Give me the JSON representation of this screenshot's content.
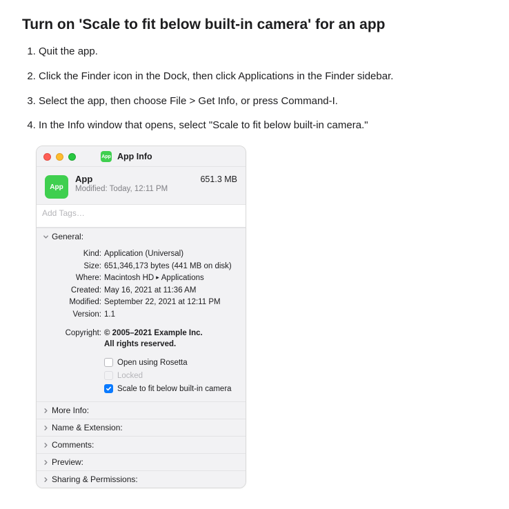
{
  "page": {
    "title": "Turn on 'Scale to fit below built-in camera' for an app",
    "steps": [
      "Quit the app.",
      "Click the Finder icon in the Dock, then click Applications in the Finder sidebar.",
      "Select the app, then choose File > Get Info, or press Command-I.",
      "In the Info window that opens, select \"Scale to fit below built-in camera.\""
    ]
  },
  "info_window": {
    "title_icon_text": "App",
    "title": "App Info",
    "header": {
      "icon_text": "App",
      "name": "App",
      "size": "651.3 MB",
      "modified_label": "Modified:",
      "modified_value": "Today, 12:11 PM"
    },
    "tags_placeholder": "Add Tags…",
    "sections": {
      "general": {
        "label": "General:",
        "rows": {
          "kind": {
            "label": "Kind:",
            "value": "Application (Universal)"
          },
          "size": {
            "label": "Size:",
            "value": "651,346,173 bytes (441 MB on disk)"
          },
          "where": {
            "label": "Where:",
            "value_parts": [
              "Macintosh HD",
              "Applications"
            ]
          },
          "created": {
            "label": "Created:",
            "value": "May 16, 2021 at 11:36 AM"
          },
          "modified": {
            "label": "Modified:",
            "value": "September 22, 2021 at 12:11 PM"
          },
          "version": {
            "label": "Version:",
            "value": "1.1"
          }
        },
        "copyright": {
          "label": "Copyright:",
          "line1": "© 2005–2021 Example Inc.",
          "line2": "All rights reserved."
        },
        "checkboxes": {
          "rosetta": {
            "label": "Open using Rosetta",
            "checked": false,
            "disabled": false
          },
          "locked": {
            "label": "Locked",
            "checked": false,
            "disabled": true
          },
          "scale": {
            "label": "Scale to fit below built-in camera",
            "checked": true,
            "disabled": false
          }
        }
      },
      "more_info": {
        "label": "More Info:"
      },
      "name_ext": {
        "label": "Name & Extension:"
      },
      "comments": {
        "label": "Comments:"
      },
      "preview": {
        "label": "Preview:"
      },
      "sharing": {
        "label": "Sharing & Permissions:"
      }
    }
  }
}
